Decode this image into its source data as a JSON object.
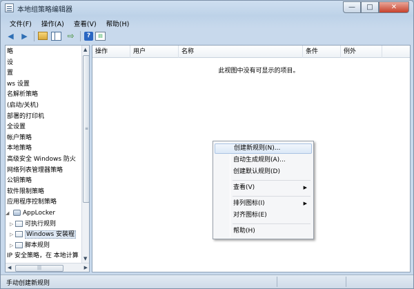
{
  "window": {
    "title": "本地组策略编辑器",
    "controls": {
      "minimize": "—",
      "maximize": "□",
      "close": "✕"
    }
  },
  "menubar": [
    "文件(F)",
    "操作(A)",
    "查看(V)",
    "帮助(H)"
  ],
  "toolbar": {
    "icons": [
      "back-arrow-icon",
      "forward-arrow-icon",
      "folder-up-icon",
      "show-hide-tree-icon",
      "export-list-icon",
      "help-icon",
      "properties-icon"
    ]
  },
  "tree": {
    "items": [
      {
        "label": "略"
      },
      {
        "label": "设"
      },
      {
        "label": "置"
      },
      {
        "label": "ws 设置"
      },
      {
        "label": "名解析策略"
      },
      {
        "label": "(启动/关机)"
      },
      {
        "label": "部署的打印机"
      },
      {
        "label": "全设置"
      },
      {
        "label": "帐户策略"
      },
      {
        "label": "本地策略"
      },
      {
        "label": "高级安全 Windows 防火"
      },
      {
        "label": "网络列表管理器策略"
      },
      {
        "label": "公钥策略"
      },
      {
        "label": "软件限制策略"
      },
      {
        "label": "应用程序控制策略"
      },
      {
        "label": "AppLocker"
      },
      {
        "label": "可执行规则"
      },
      {
        "label": "Windows 安装程"
      },
      {
        "label": "脚本规则"
      },
      {
        "label": "IP 安全策略，在 本地计算"
      }
    ]
  },
  "columns": [
    "操作",
    "用户",
    "名称",
    "条件",
    "例外"
  ],
  "empty_message": "此视图中没有可显示的项目。",
  "context_menu": {
    "items": [
      {
        "label": "创建新规则(N)..."
      },
      {
        "label": "自动生成规则(A)..."
      },
      {
        "label": "创建默认规则(D)"
      },
      {
        "label": "查看(V)"
      },
      {
        "label": "排列图标(I)"
      },
      {
        "label": "对齐图标(E)"
      },
      {
        "label": "帮助(H)"
      }
    ]
  },
  "status": {
    "text": "手动创建新规则"
  }
}
